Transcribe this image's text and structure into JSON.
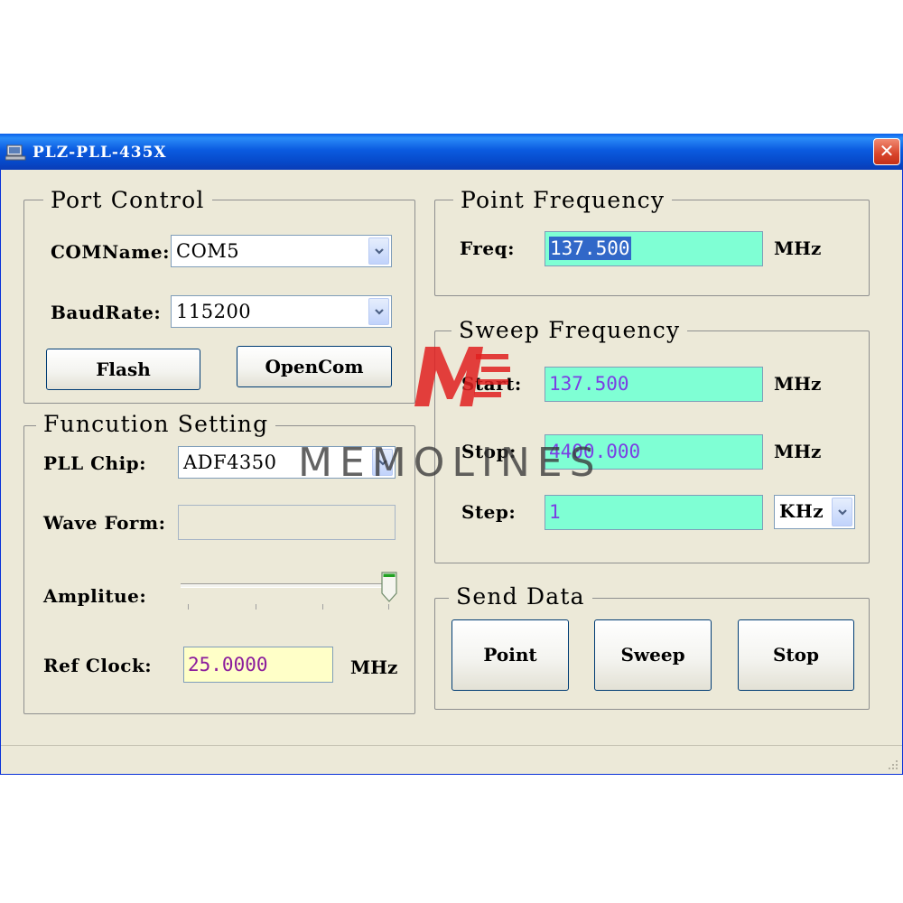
{
  "window": {
    "title": "PLZ-PLL-435X",
    "close_glyph": "✕"
  },
  "port_control": {
    "legend": "Port Control",
    "comname_label": "COMName:",
    "comname_value": "COM5",
    "baudrate_label": "BaudRate:",
    "baudrate_value": "115200",
    "flash_label": "Flash",
    "opencom_label": "OpenCom"
  },
  "function_setting": {
    "legend": "Funcution Setting",
    "pll_chip_label": "PLL Chip:",
    "pll_chip_value": "ADF4350",
    "wave_form_label": "Wave Form:",
    "wave_form_value": "",
    "amplitude_label": "Amplitue:",
    "amplitude_level": 1.0,
    "ref_clock_label": "Ref Clock:",
    "ref_clock_value": "25.0000",
    "ref_clock_unit": "MHz"
  },
  "point_frequency": {
    "legend": "Point Frequency",
    "freq_label": "Freq:",
    "freq_value": "137.500",
    "freq_unit": "MHz"
  },
  "sweep_frequency": {
    "legend": "Sweep Frequency",
    "start_label": "Start:",
    "start_value": "137.500",
    "start_unit": "MHz",
    "stop_label": "Stop:",
    "stop_value": "4400.000",
    "stop_unit": "MHz",
    "step_label": "Step:",
    "step_value": "1",
    "step_unit": "KHz"
  },
  "send_data": {
    "legend": "Send Data",
    "point_label": "Point",
    "sweep_label": "Sweep",
    "stop_label": "Stop"
  },
  "watermark": {
    "text": "MEMOLINES"
  },
  "colors": {
    "title_bar": "#0b5be0",
    "window_bg": "#ece9d8",
    "field_bg": "#7fffd4",
    "ref_field_bg": "#ffffc8",
    "value_text": "#7b3fe4",
    "watermark_red": "#e02020"
  },
  "icons": {
    "app": "computer-icon",
    "close": "close-icon",
    "dropdown": "chevron-down-icon",
    "slider": "slider-thumb-icon"
  }
}
